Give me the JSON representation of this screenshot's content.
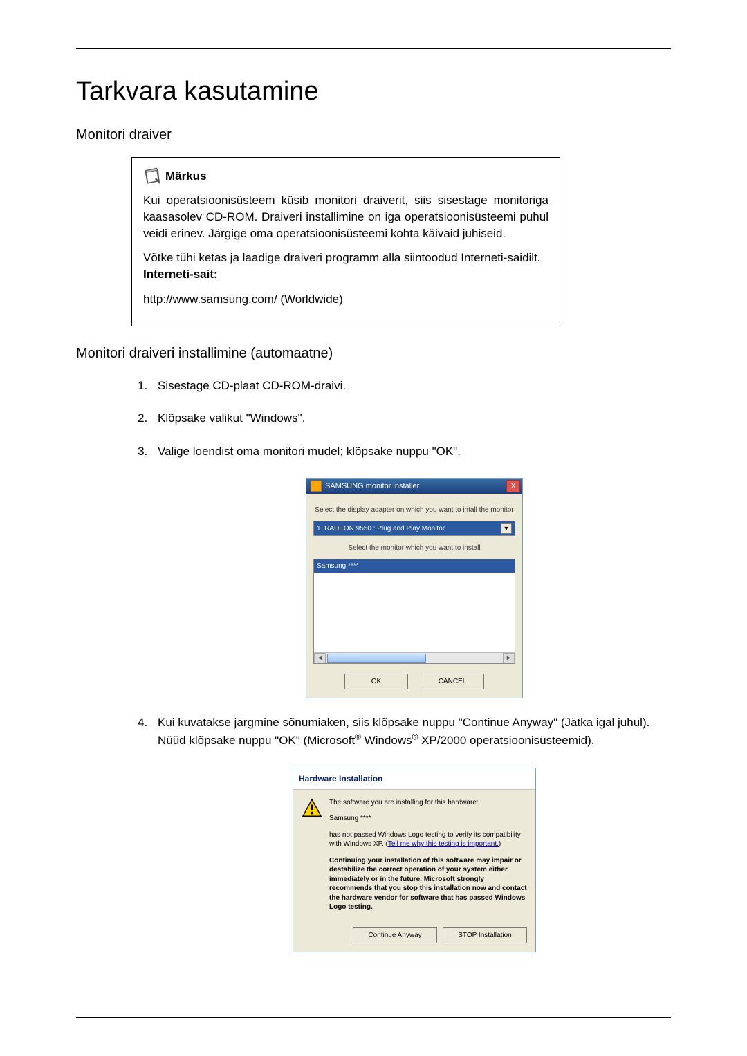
{
  "title": "Tarkvara kasutamine",
  "sections": {
    "monitor_driver": "Monitori draiver",
    "auto_install": "Monitori draiveri installimine (automaatne)"
  },
  "note": {
    "label": "Märkus",
    "p1": "Kui operatsioonisüsteem küsib monitori draiverit, siis sisestage monitoriga kaasasolev CD-ROM. Draiveri installimine on iga operatsioonisüsteemi puhul veidi erinev. Järgige oma operatsioonisüsteemi kohta käivaid juhiseid.",
    "p2_pre": "Võtke tühi ketas ja laadige draiveri programm alla siintoodud Interneti-saidilt.",
    "p2_bold": "Interneti-sait:",
    "url": "http://www.samsung.com/ (Worldwide)"
  },
  "steps": {
    "s1": "Sisestage CD-plaat CD-ROM-draivi.",
    "s2": "Klõpsake valikut \"Windows\".",
    "s3": "Valige loendist oma monitori mudel; klõpsake nuppu \"OK\".",
    "s4_a": "Kui kuvatakse järgmine sõnumiaken, siis klõpsake nuppu \"Continue Anyway\" (Jätka igal juhul). Nüüd klõpsake nuppu \"OK\" (Microsoft",
    "s4_b": " Windows",
    "s4_c": " XP/2000 operatsioonisüsteemid)."
  },
  "installer": {
    "title": "SAMSUNG monitor installer",
    "instr1": "Select the display adapter on which you want to intall the monitor",
    "adapter_option": "1. RADEON 9550 : Plug and Play Monitor",
    "instr2": "Select the monitor which you want to install",
    "list_item": "Samsung ****",
    "ok": "OK",
    "cancel": "CANCEL",
    "close": "X"
  },
  "warn": {
    "header": "Hardware Installation",
    "line1": "The software you are installing for this hardware:",
    "device": "Samsung ****",
    "line2a": "has not passed Windows Logo testing to verify its compatibility with Windows XP. (",
    "link": "Tell me why this testing is important.",
    "line2b": ")",
    "bold": "Continuing your installation of this software may impair or destabilize the correct operation of your system either immediately or in the future. Microsoft strongly recommends that you stop this installation now and contact the hardware vendor for software that has passed Windows Logo testing.",
    "btn_continue": "Continue Anyway",
    "btn_stop": "STOP Installation"
  }
}
